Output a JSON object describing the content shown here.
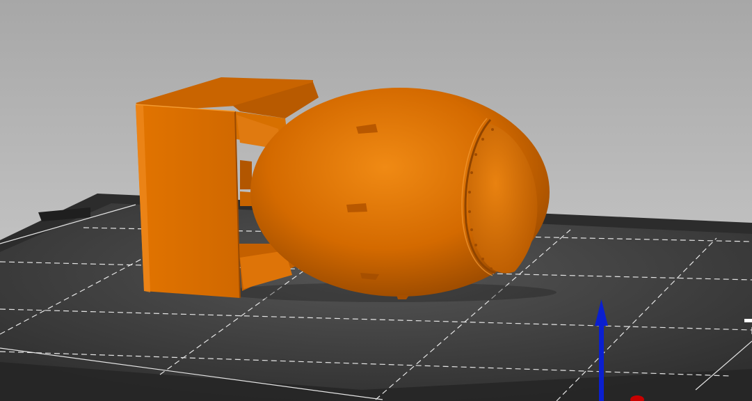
{
  "view": {
    "type": "3d-viewport",
    "background_top_color": "#a7a7a7",
    "background_bottom_color": "#cfcfcf",
    "model_color": "#e07000",
    "bed_color": "#3a3a3a",
    "grid_line_color": "#ffffff"
  },
  "model": {
    "name_icon": "bomb-model",
    "parts": [
      "tail-fin-box",
      "bomb-body",
      "nose-cap"
    ]
  },
  "bed": {
    "icon": "print-bed"
  },
  "axes": {
    "z_axis_color": "#0a1fd0",
    "x_axis_color": "#c80000"
  }
}
